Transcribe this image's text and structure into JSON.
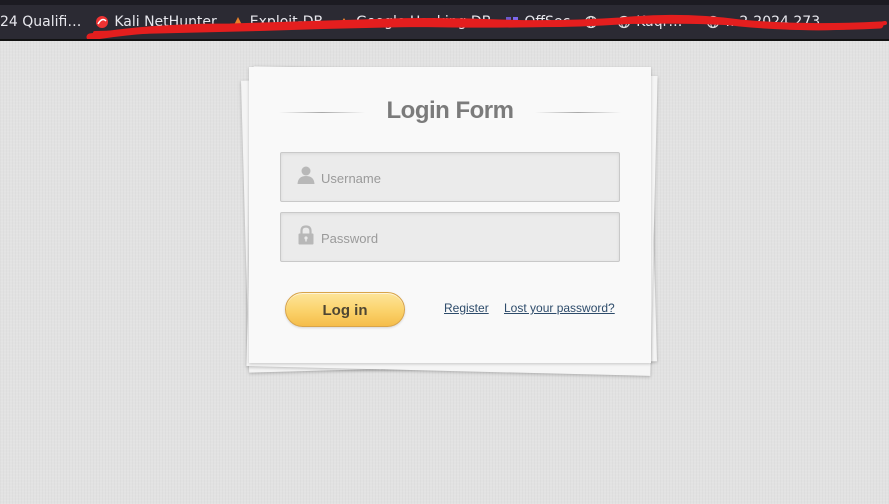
{
  "bookmarks": [
    {
      "label": "24 Qualifi…",
      "icon": "none"
    },
    {
      "label": "Kali NetHunter",
      "icon": "kali-dragon-icon"
    },
    {
      "label": "Exploit-DB",
      "icon": "exploit-db-icon"
    },
    {
      "label": "Google Hacking DB",
      "icon": "ghdb-icon"
    },
    {
      "label": "OffSec",
      "icon": "offsec-icon"
    },
    {
      "label": "",
      "icon": "globe-icon"
    },
    {
      "label": "Kaqr…",
      "icon": "globe-icon"
    },
    {
      "label": "…2-2024 273…",
      "icon": "globe-icon"
    }
  ],
  "login": {
    "title": "Login Form",
    "username_placeholder": "Username",
    "password_placeholder": "Password",
    "login_label": "Log in",
    "register_label": "Register",
    "lost_password_label": "Lost your password?"
  },
  "colors": {
    "accent_button": "#fbd46e",
    "link": "#2e4c6b",
    "title": "#7b7b7b",
    "scribble": "#e41e1e"
  }
}
